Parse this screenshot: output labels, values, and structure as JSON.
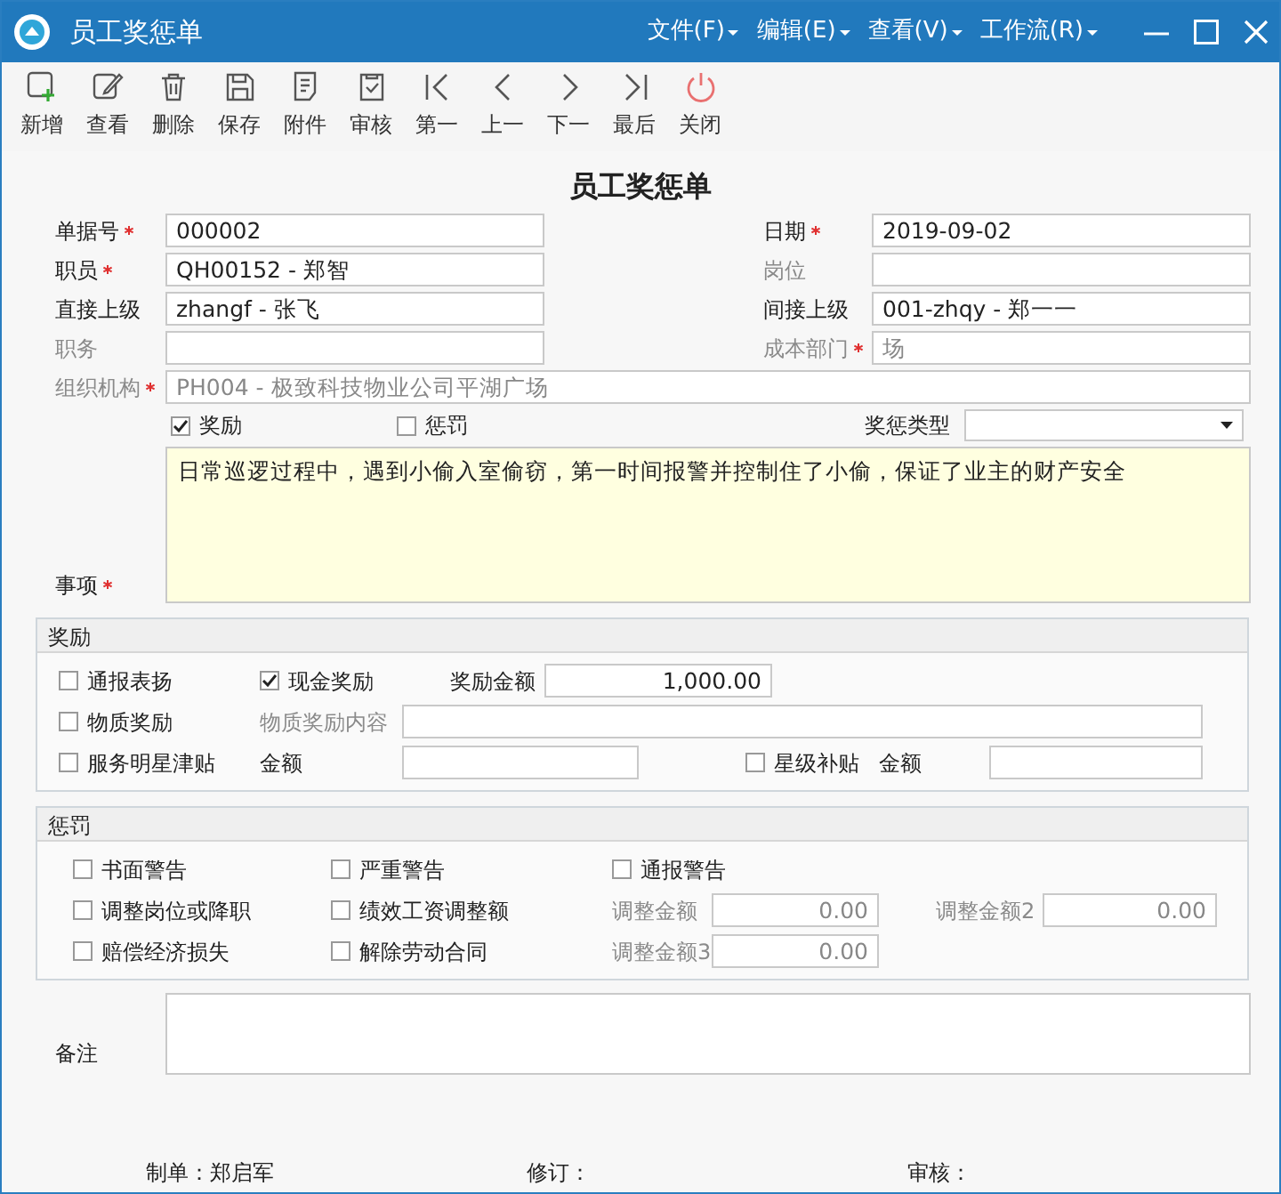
{
  "window": {
    "title": "员工奖惩单"
  },
  "menu": [
    {
      "label": "文件(F)"
    },
    {
      "label": "编辑(E)"
    },
    {
      "label": "查看(V)"
    },
    {
      "label": "工作流(R)"
    }
  ],
  "toolbar": [
    {
      "kind": "new",
      "label": "新增"
    },
    {
      "kind": "view",
      "label": "查看"
    },
    {
      "kind": "delete",
      "label": "删除"
    },
    {
      "kind": "save",
      "label": "保存"
    },
    {
      "kind": "attach",
      "label": "附件"
    },
    {
      "kind": "audit",
      "label": "审核"
    },
    {
      "kind": "first",
      "label": "第一"
    },
    {
      "kind": "prev",
      "label": "上一"
    },
    {
      "kind": "next",
      "label": "下一"
    },
    {
      "kind": "last",
      "label": "最后"
    },
    {
      "kind": "close",
      "label": "关闭"
    }
  ],
  "form": {
    "title": "员工奖惩单",
    "header_rows": [
      [
        {
          "label": "单据号",
          "required": true,
          "disabled": false,
          "value": "000002"
        },
        {
          "label": "日期",
          "required": true,
          "disabled": false,
          "value": "2019-09-02"
        }
      ],
      [
        {
          "label": "职员",
          "required": true,
          "disabled": false,
          "value": "QH00152 - 郑智"
        },
        {
          "label": "岗位",
          "required": false,
          "disabled": true
        }
      ],
      [
        {
          "label": "直接上级",
          "required": false,
          "disabled": false,
          "value": "zhangf  - 张飞"
        },
        {
          "label": "间接上级",
          "required": false,
          "disabled": false,
          "value": "001-zhqy  - 郑一一"
        }
      ],
      [
        {
          "label": "职务",
          "required": false,
          "disabled": true
        },
        {
          "label": "成本部门",
          "required": true,
          "disabled": true,
          "value": "场"
        }
      ],
      [
        {
          "label": "组织机构",
          "required": true,
          "disabled": true,
          "value": "PH004  - 极致科技物业公司平湖广场"
        }
      ]
    ],
    "type_row": {
      "checks": [
        {
          "label": "奖励",
          "checked": true
        },
        {
          "label": "惩罚",
          "checked": false
        }
      ],
      "select_label": "奖惩类型"
    },
    "matter": {
      "label": "事项",
      "required": true,
      "value": "日常巡逻过程中，遇到小偷入室偷窃，第一时间报警并控制住了小偷，保证了业主的财产安全"
    },
    "sections": [
      {
        "title": "奖励",
        "rows": [
          [
            {
              "kind": "checkbox",
              "label": "通报表扬",
              "checked": false
            },
            {
              "kind": "checkbox",
              "label": "现金奖励",
              "checked": true
            },
            {
              "kind": "field",
              "label": "奖励金额",
              "disabled": false,
              "value": "1,000.00"
            }
          ],
          [
            {
              "kind": "checkbox",
              "label": "物质奖励",
              "checked": false
            },
            {
              "kind": "field",
              "label": "物质奖励内容",
              "disabled": true
            }
          ],
          [
            {
              "kind": "checkbox",
              "label": "服务明星津贴",
              "checked": false
            },
            {
              "kind": "field",
              "label": "金额",
              "disabled": false
            },
            {
              "kind": "checkbox",
              "label": "星级补贴",
              "checked": false
            },
            {
              "kind": "field",
              "label": "金额",
              "disabled": false
            }
          ]
        ]
      },
      {
        "title": "惩罚",
        "rows": [
          [
            {
              "kind": "checkbox",
              "label": "书面警告",
              "checked": false
            },
            {
              "kind": "checkbox",
              "label": "严重警告",
              "checked": false
            },
            {
              "kind": "checkbox",
              "label": "通报警告",
              "checked": false
            }
          ],
          [
            {
              "kind": "checkbox",
              "label": "调整岗位或降职",
              "checked": false
            },
            {
              "kind": "checkbox",
              "label": "绩效工资调整额",
              "checked": false
            },
            {
              "kind": "field",
              "label": "调整金额",
              "disabled": true,
              "value": "0.00"
            },
            {
              "kind": "field",
              "label": "调整金额2",
              "disabled": true,
              "value": "0.00"
            }
          ],
          [
            {
              "kind": "checkbox",
              "label": "赔偿经济损失",
              "checked": false
            },
            {
              "kind": "checkbox",
              "label": "解除劳动合同",
              "checked": false
            },
            {
              "kind": "field",
              "label": "调整金额3",
              "disabled": true,
              "value": "0.00"
            }
          ]
        ]
      }
    ],
    "remark": {
      "label": "备注"
    },
    "footer": [
      {
        "label": "制单：郑启军"
      },
      {
        "label": "修订："
      },
      {
        "label": "审核："
      }
    ]
  }
}
